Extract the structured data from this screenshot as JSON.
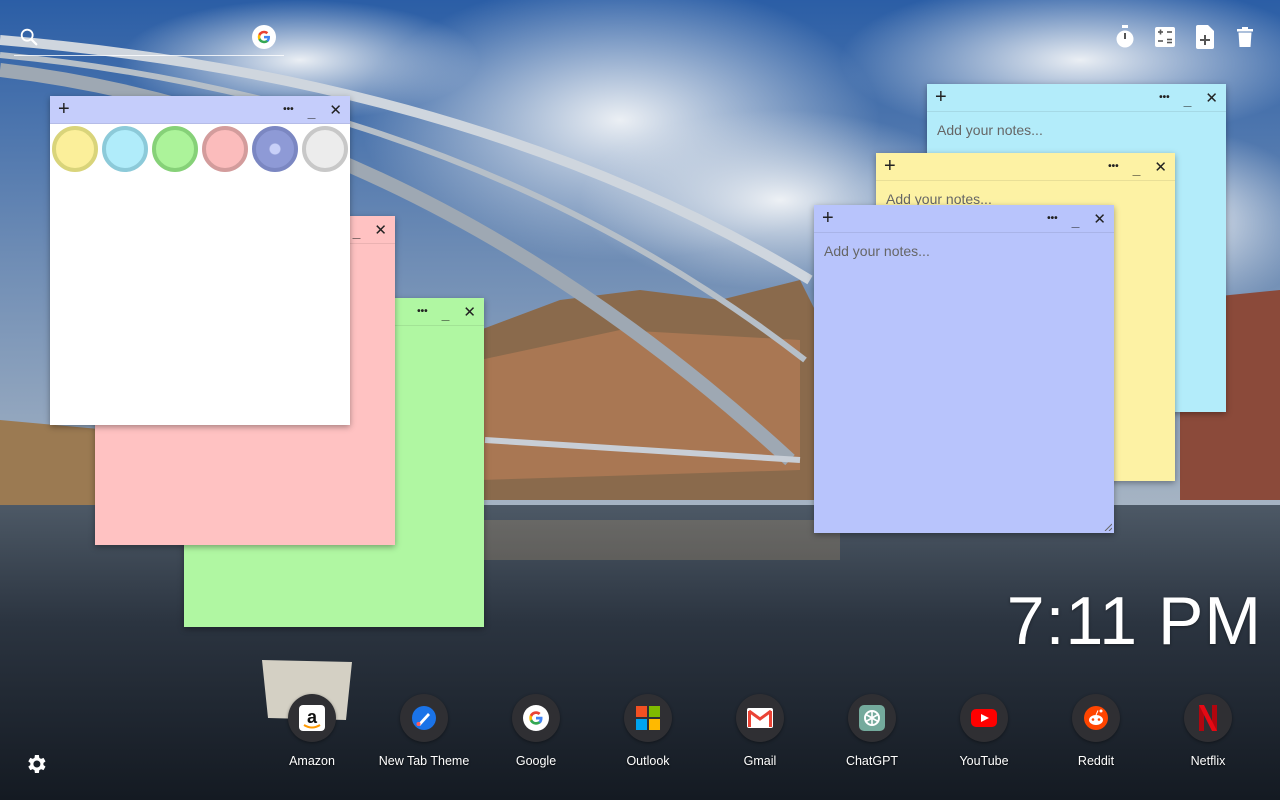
{
  "search": {
    "placeholder": ""
  },
  "top_tools": [
    "timer-icon",
    "calculator-icon",
    "add-note-icon",
    "trash-icon"
  ],
  "colors": {
    "white_note": "#ffffff",
    "header_blue": "#c5cdfb",
    "pink_note": "#ffc2c2",
    "green_note": "#b0f7a2",
    "cyan_note": "#b3ecfa",
    "yellow_note": "#fdf2a4",
    "blue_note": "#b8c4fc"
  },
  "swatches": [
    {
      "name": "yellow",
      "fill": "#fbef9a",
      "border": "#d9d47a"
    },
    {
      "name": "cyan",
      "fill": "#b0ecfa",
      "border": "#8ccad9"
    },
    {
      "name": "green",
      "fill": "#acf39a",
      "border": "#86d178"
    },
    {
      "name": "pink",
      "fill": "#fbbcbc",
      "border": "#d39c9c"
    },
    {
      "name": "blue",
      "fill": "#8e9ad6",
      "border": "#7b87c2"
    },
    {
      "name": "gray",
      "fill": "#ececec",
      "border": "#c8c8c8"
    }
  ],
  "notes": {
    "placeholder": "Add your notes...",
    "plus": "+",
    "more": "•••",
    "minimize": "_",
    "close": "✕"
  },
  "clock": {
    "time": "7:11 PM"
  },
  "shortcuts": [
    {
      "label": "Amazon"
    },
    {
      "label": "New Tab Theme"
    },
    {
      "label": "Google"
    },
    {
      "label": "Outlook"
    },
    {
      "label": "Gmail"
    },
    {
      "label": "ChatGPT"
    },
    {
      "label": "YouTube"
    },
    {
      "label": "Reddit"
    },
    {
      "label": "Netflix"
    }
  ]
}
